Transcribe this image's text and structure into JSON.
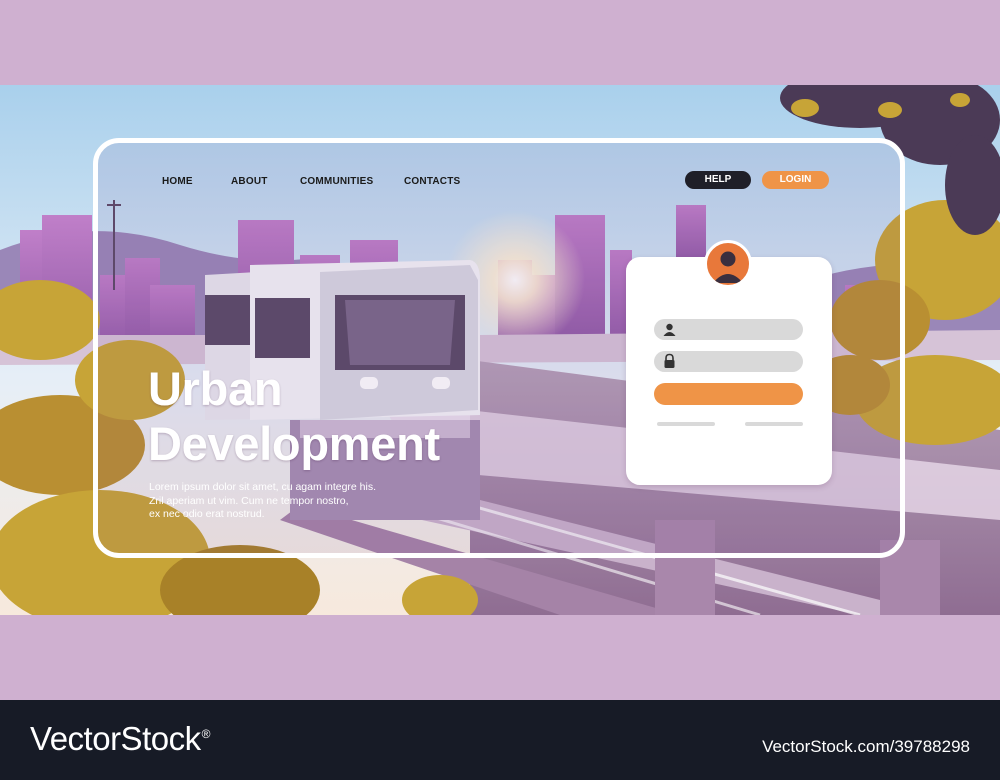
{
  "nav": {
    "items": [
      "HOME",
      "ABOUT",
      "COMMUNITIES",
      "CONTACTS"
    ],
    "help_label": "HELP",
    "login_label": "LOGIN"
  },
  "hero": {
    "title_line1": "Urban",
    "title_line2": "Development",
    "description_line1": "Lorem ipsum dolor sit amet, cu agam integre his.",
    "description_line2": "Zril aperiam ut vim. Cum ne tempor nostro,",
    "description_line3": "ex nec odio erat nostrud."
  },
  "login_card": {
    "username_icon": "user-icon",
    "password_icon": "lock-icon",
    "avatar_icon": "user-avatar-icon"
  },
  "footer": {
    "brand": "VectorStock",
    "trademark": "®",
    "credit": "VectorStock.com/39788298"
  },
  "colors": {
    "background_band": "#cfb0d0",
    "accent_orange": "#ef9447",
    "help_pill": "#1f1f28",
    "footer": "#171b26",
    "sky": "#bcd9ee",
    "foliage": "#c7a437"
  }
}
